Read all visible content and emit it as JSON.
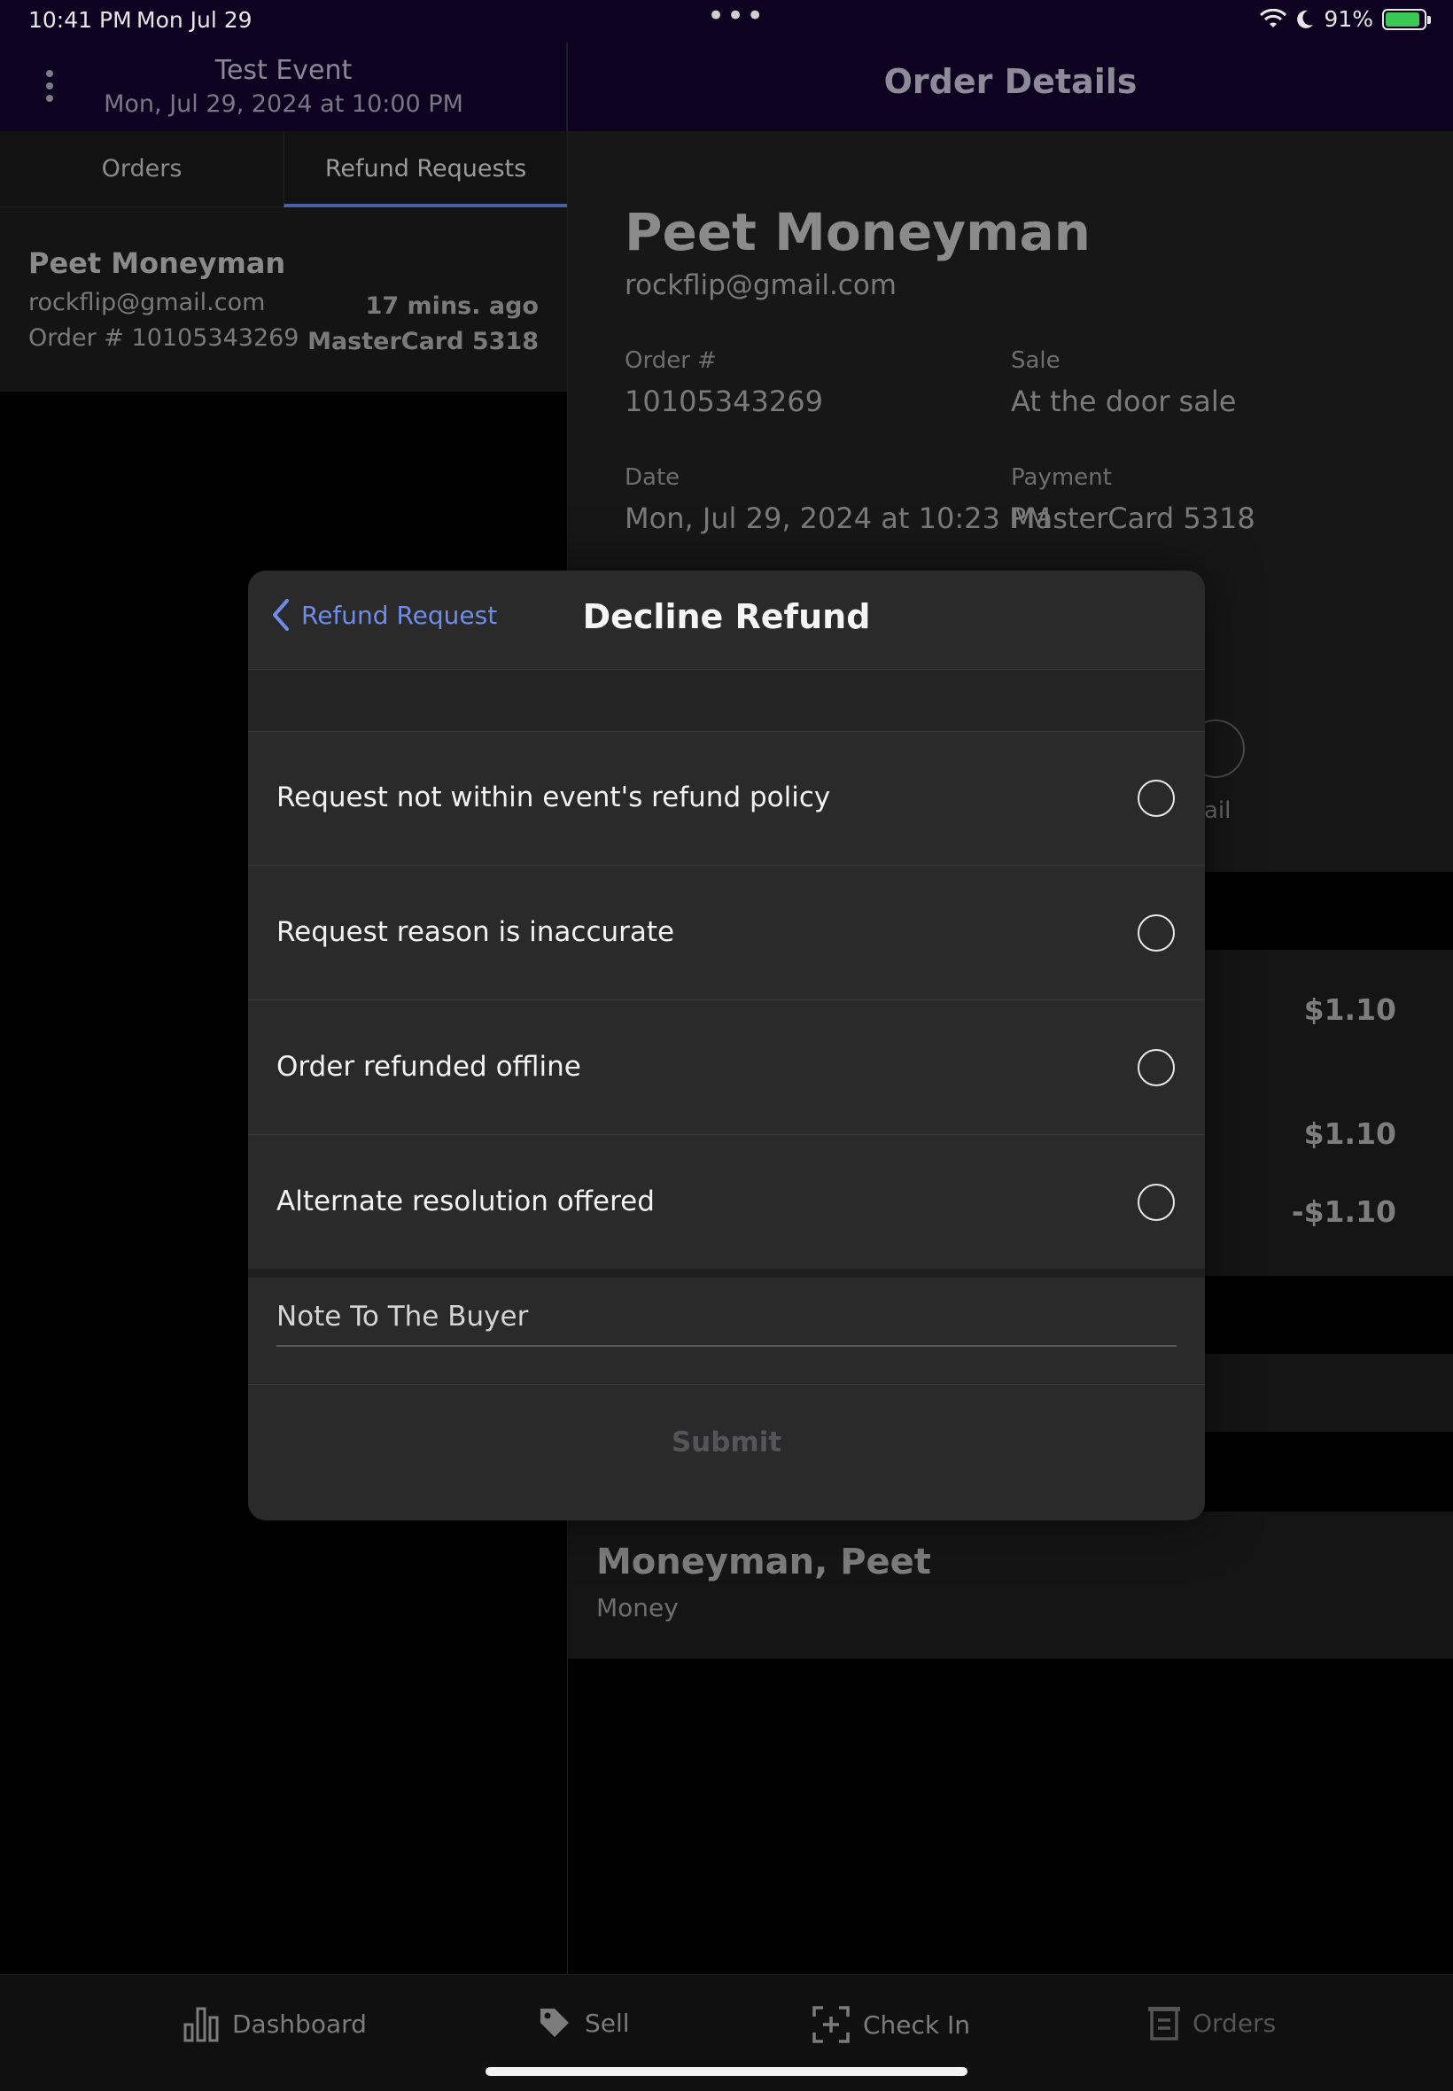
{
  "status_bar": {
    "time": "10:41 PM",
    "date": "Mon Jul 29",
    "battery": "91%",
    "battery_level": 0.91
  },
  "event_header": {
    "title": "Test Event",
    "subtitle": "Mon, Jul 29, 2024 at 10:00 PM"
  },
  "tabs": [
    {
      "label": "Orders",
      "selected": false
    },
    {
      "label": "Refund Requests",
      "selected": true
    }
  ],
  "refund_request_item": {
    "name": "Peet Moneyman",
    "email": "rockflip@gmail.com",
    "order": "Order # 10105343269",
    "time_ago": "17 mins. ago",
    "card": "MasterCard 5318"
  },
  "order_details": {
    "header_title": "Order Details",
    "name": "Peet Moneyman",
    "email": "rockflip@gmail.com",
    "order_label": "Order #",
    "order_value": "10105343269",
    "sale_label": "Sale",
    "sale_value": "At the door sale",
    "date_label": "Date",
    "date_value": "Mon, Jul 29, 2024 at 10:23 PM",
    "payment_label": "Payment",
    "payment_value": "MasterCard 5318",
    "email_action_partial": "ail",
    "prices": [
      "$1.10",
      "$1.10",
      "-$1.10"
    ],
    "attendee_name": "Moneyman, Peet",
    "attendee_ticket": "Money"
  },
  "modal": {
    "back_label": "Refund Request",
    "title": "Decline Refund",
    "options": [
      {
        "label": "Request not within event's refund policy",
        "selected": false
      },
      {
        "label": "Request reason is inaccurate",
        "selected": false
      },
      {
        "label": "Order refunded offline",
        "selected": false
      },
      {
        "label": "Alternate resolution offered",
        "selected": false
      }
    ],
    "note_placeholder": "Note To The Buyer",
    "submit_label": "Submit"
  },
  "bottom_nav": [
    {
      "label": "Dashboard",
      "icon": "bar-chart-icon"
    },
    {
      "label": "Sell",
      "icon": "tag-icon"
    },
    {
      "label": "Check In",
      "icon": "scan-plus-icon"
    },
    {
      "label": "Orders",
      "icon": "orders-icon"
    }
  ],
  "colors": {
    "accent_link": "#6f8ce8",
    "tab_underline": "#4b5fa8",
    "header_bg": "#0d0320",
    "modal_bg": "#2a2a2b",
    "battery_green": "#39c853"
  }
}
